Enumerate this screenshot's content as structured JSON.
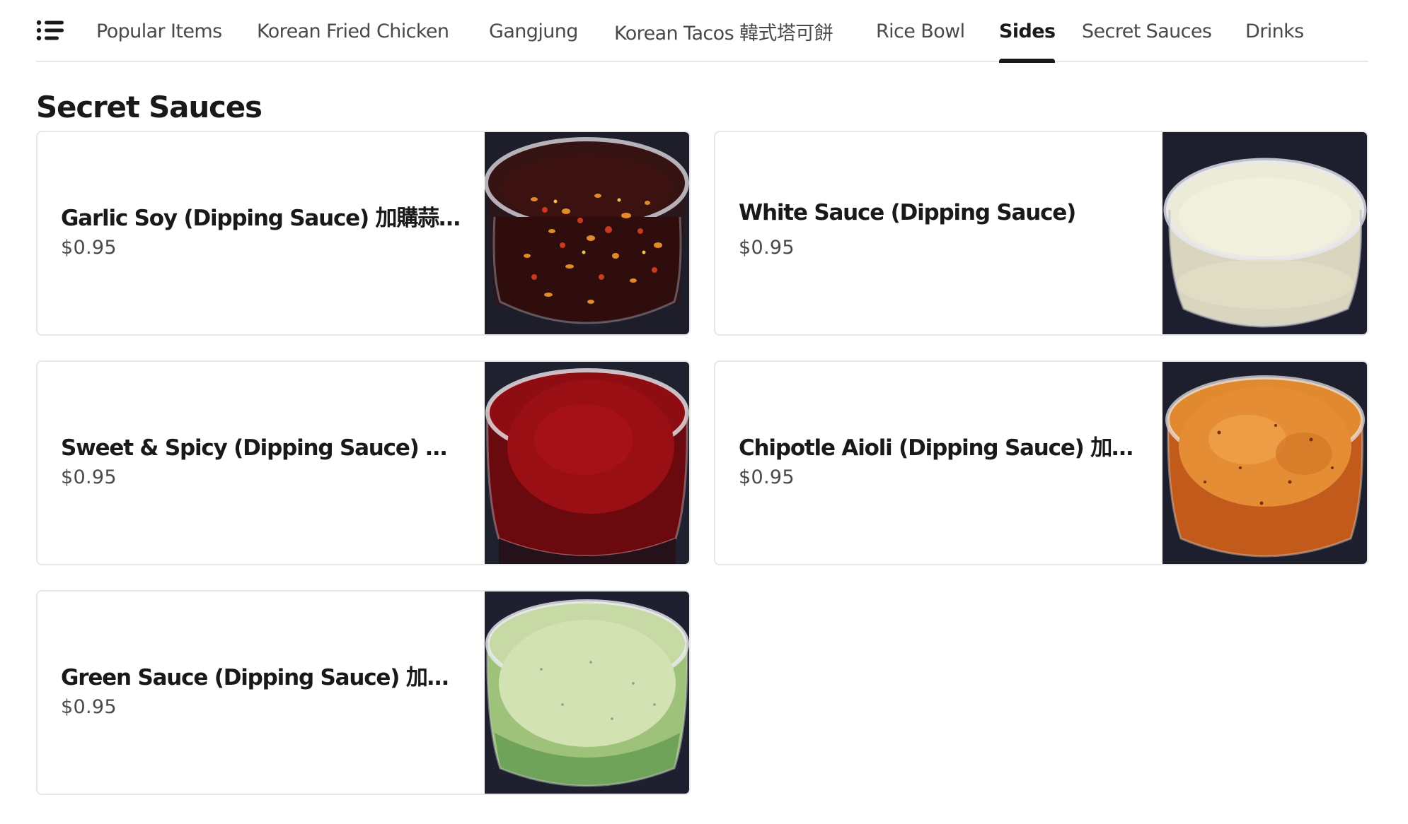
{
  "nav": {
    "tabs": [
      {
        "label": "Popular Items"
      },
      {
        "label": "Korean Fried Chicken"
      },
      {
        "label": "Gangjung"
      },
      {
        "label": "Korean Tacos 韓式塔可餅"
      },
      {
        "label": "Rice Bowl"
      },
      {
        "label": "Sides",
        "active": true
      },
      {
        "label": "Secret Sauces"
      },
      {
        "label": "Drinks"
      }
    ]
  },
  "section": {
    "title": "Secret Sauces",
    "items": [
      {
        "name": "Garlic Soy (Dipping Sauce) 加購蒜蓉醬",
        "price": "$0.95",
        "image": "garlic-soy-sauce-image"
      },
      {
        "name": "White Sauce (Dipping Sauce)",
        "price": "$0.95",
        "image": "white-sauce-image"
      },
      {
        "name": "Sweet & Spicy (Dipping Sauce) 加購甜…",
        "price": "$0.95",
        "image": "sweet-spicy-sauce-image"
      },
      {
        "name": "Chipotle Aioli (Dipping Sauce) 加購橘醬",
        "price": "$0.95",
        "image": "chipotle-aioli-image"
      },
      {
        "name": "Green Sauce (Dipping Sauce) 加購綠醬",
        "price": "$0.95",
        "image": "green-sauce-image"
      }
    ]
  },
  "colors": {
    "text_primary": "#191919",
    "text_secondary": "#494949",
    "border": "#e7e7e7",
    "photo_background": "#1d1d2a"
  }
}
